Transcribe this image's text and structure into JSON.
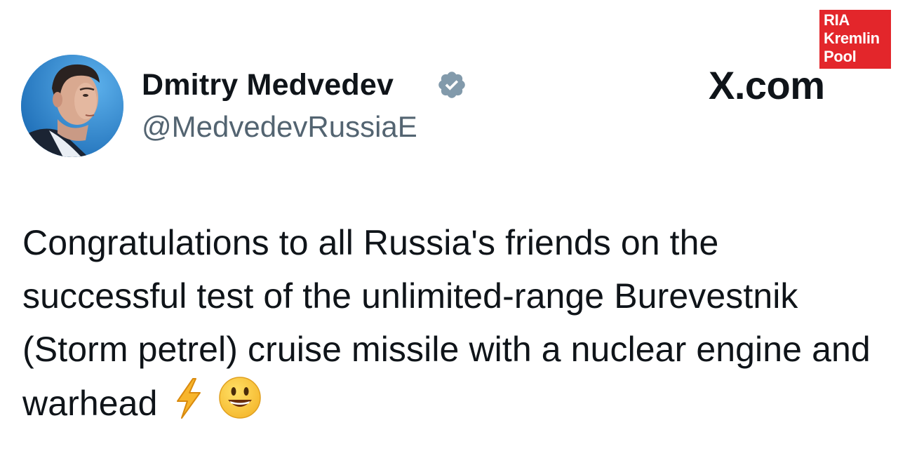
{
  "author": {
    "name": "Dmitry Medvedev",
    "handle": "@MedvedevRussiaE",
    "verified": true
  },
  "site": {
    "label": "X.com"
  },
  "watermark": {
    "lines": [
      "RIA",
      "Kremlin",
      "Pool"
    ],
    "color": "#e3262b"
  },
  "tweet": {
    "text": "Congratulations to all Russia's friends on the successful test of the unlimited-range Burevestnik (Storm petrel) cruise missile with a nuclear engine and warhead",
    "emojis": [
      "lightning-emoji",
      "smiling-face-emoji"
    ]
  },
  "colors": {
    "text": "#0f1419",
    "handle": "#536471",
    "verified_badge": "#829aab"
  }
}
